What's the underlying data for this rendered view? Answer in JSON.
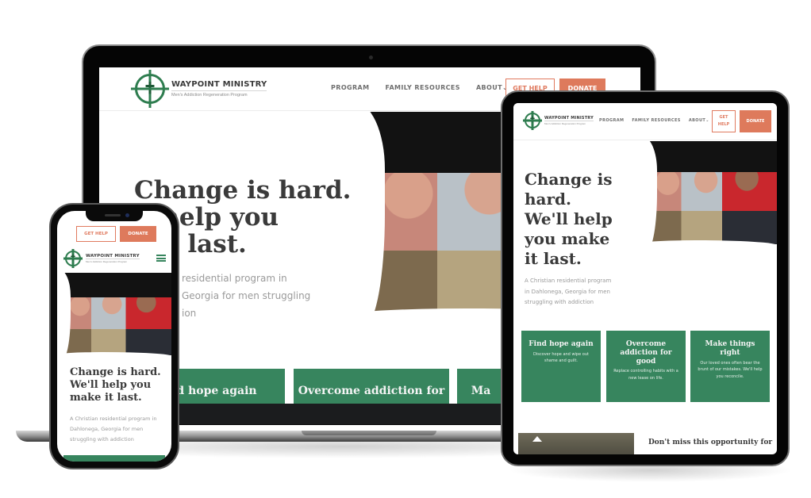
{
  "site": {
    "brand": "WAYPOINT MINISTRY",
    "tagline": "Men's Addiction Regeneration Program",
    "nav": [
      "PROGRAM",
      "FAMILY RESOURCES",
      "ABOUT"
    ],
    "about_caret": "⌄",
    "get_help": "GET HELP",
    "donate": "DONATE",
    "hero_title": "Change is hard. We'll help you make it last.",
    "hero_title_laptop_lines": [
      "Change is hard.",
      "ll help you",
      "e it last."
    ],
    "hero_sub": "A Christian residential program in Dahlonega, Georgia for men struggling with addiction",
    "hero_sub_laptop_lines": [
      "residential program in",
      "Georgia for men struggling",
      "ion"
    ],
    "cards": [
      {
        "title": "Find hope again",
        "laptop_title": "d hope again",
        "desc": "Discover hope and wipe out shame and guilt."
      },
      {
        "title": "Overcome addiction for good",
        "laptop_title": "Overcome addiction for",
        "desc": "Replace controlling habits with a new lease on life."
      },
      {
        "title": "Make things right",
        "laptop_title": "Ma",
        "desc": "Our loved ones often bear the brunt of our mistakes. We'll help you reconcile."
      }
    ],
    "tablet_next_heading": "Don't miss this opportunity for"
  },
  "colors": {
    "brand_green": "#37855e",
    "logo_green": "#2e7d4f",
    "accent_orange": "#de7a5c",
    "heading": "#3a3a3a",
    "body": "#9a9a9a"
  }
}
